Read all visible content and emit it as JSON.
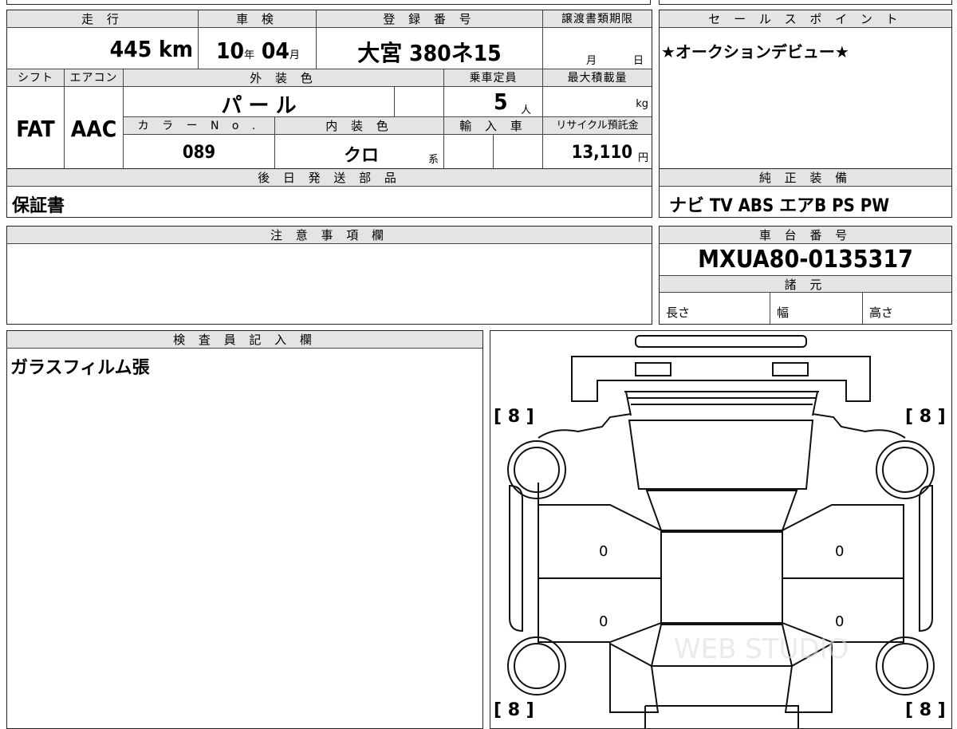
{
  "headers": {
    "mileage": "走 行",
    "inspection": "車 検",
    "registration": "登 録 番 号",
    "transfer_deadline": "譲渡書類期限",
    "sales_point": "セ ー ル ス ポ イ ン ト",
    "shift": "シフト",
    "aircon": "エアコン",
    "exterior_color": "外 装 色",
    "capacity": "乗車定員",
    "max_load": "最大積載量",
    "color_no": "カ ラ ー N o .",
    "interior_color": "内 装 色",
    "import": "輸 入 車",
    "recycle": "リサイクル預託金",
    "later_parts": "後 日 発 送 部 品",
    "genuine_equipment": "純 正 装 備",
    "notes": "注 意 事 項 欄",
    "chassis_no": "車 台 番 号",
    "specs": "諸 元",
    "inspector": "検 査 員 記 入 欄"
  },
  "values": {
    "mileage": "445",
    "mileage_unit": "km",
    "inspection_year": "10",
    "inspection_year_unit": "年",
    "inspection_month": "04",
    "inspection_month_unit": "月",
    "registration_number": "大宮 380ネ15",
    "transfer_month_label": "月",
    "transfer_day_label": "日",
    "sales_point": "★オークションデビュー★",
    "shift": "FAT",
    "aircon": "AAC",
    "exterior_color": "パ ー ル",
    "capacity": "5",
    "capacity_unit": "人",
    "max_load_unit": "kg",
    "color_no": "089",
    "interior_color": "クロ",
    "interior_suffix": "系",
    "recycle_fee": "13,110",
    "recycle_unit": "円",
    "later_parts": "保証書",
    "genuine_equipment": "ナビ TV ABS エアB PS PW",
    "chassis_no": "MXUA80-0135317",
    "length_label": "長さ",
    "width_label": "幅",
    "height_label": "高さ",
    "inspector_notes": "ガラスフィルム張"
  },
  "diagram": {
    "front_left_tire": "[ 8 ]",
    "front_right_tire": "[ 8 ]",
    "rear_left_tire": "[ 8 ]",
    "rear_right_tire": "[ 8 ]",
    "door_marks": [
      "0",
      "0",
      "0",
      "0"
    ],
    "watermark": "WEB STUDIO"
  }
}
